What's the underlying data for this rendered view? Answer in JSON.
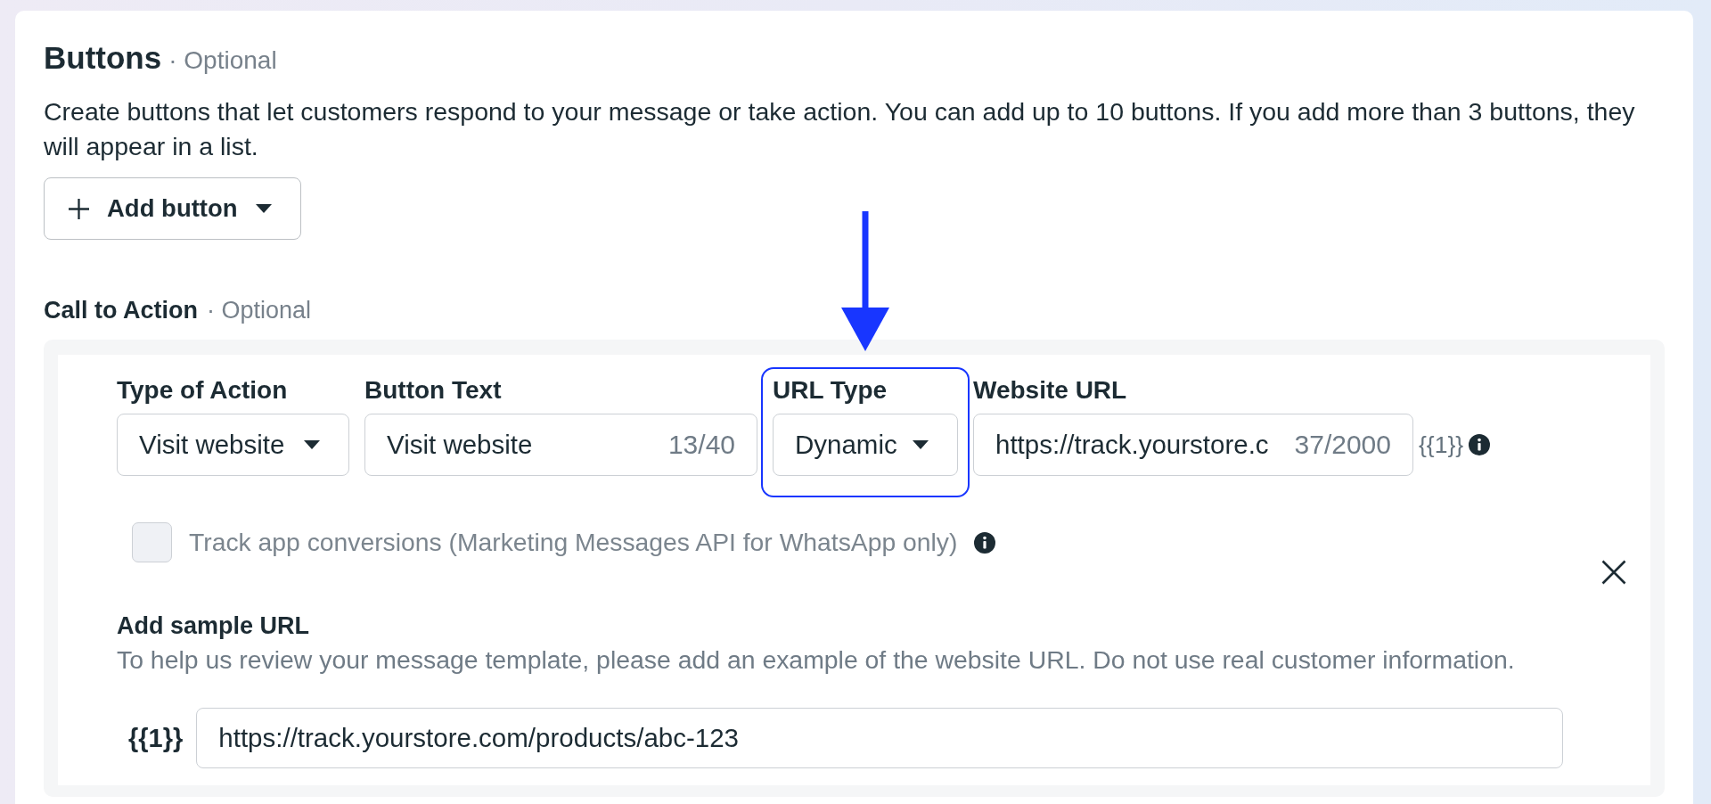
{
  "buttons_section": {
    "title": "Buttons",
    "optional": "· Optional",
    "description": "Create buttons that let customers respond to your message or take action. You can add up to 10 buttons. If you add more than 3 buttons, they will appear in a list.",
    "add_button": {
      "label": "Add button"
    }
  },
  "call_to_action": {
    "title": "Call to Action",
    "optional": "· Optional",
    "fields": [
      {
        "kind": "select",
        "label": "Type of Action",
        "value": "Visit website",
        "highlighted": false
      },
      {
        "kind": "text",
        "label": "Button Text",
        "value": "Visit website",
        "counter": "13/40",
        "highlighted": false
      },
      {
        "kind": "select",
        "label": "URL Type",
        "value": "Dynamic",
        "highlighted": true
      },
      {
        "kind": "text",
        "label": "Website URL",
        "value": "https://track.yourstore.c",
        "counter": "37/2000",
        "suffix": "{{1}}",
        "info": true,
        "highlighted": false
      }
    ],
    "checkbox": {
      "label": "Track app conversions (Marketing Messages API for WhatsApp only)",
      "checked": false,
      "disabled": true,
      "info": true
    },
    "sample": {
      "title": "Add sample URL",
      "help": "To help us review your message template, please add an example of the website URL. Do not use real customer information.",
      "variable": "{{1}}",
      "value": "https://track.yourstore.com/products/abc-123"
    }
  }
}
